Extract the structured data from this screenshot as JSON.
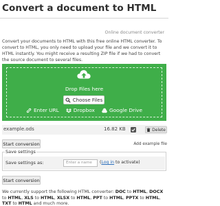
{
  "title": "Convert a document to HTML",
  "subtitle": "Online document converter",
  "intro": "Convert your documents to HTML with this free online HTML converter. To convert to HTML, you only need to upload your file and we convert it to HTML instantly. You might receive a resulting ZIP file if we had to convert the source document to several files.",
  "dropzone": {
    "drop_text": "Drop Files here",
    "choose_label": "Choose Files",
    "sources": [
      "Enter URL",
      "Dropbox",
      "Google Drive"
    ],
    "bg_color": "#3fae49"
  },
  "file": {
    "name": "example.ods",
    "size": "16.82 KB",
    "delete_label": "Delete"
  },
  "start_label": "Start conversion",
  "add_example_label": "Add example file",
  "settings": {
    "legend": "Save settings",
    "save_as_label": "Save settings as:",
    "input_placeholder": "Enter a name",
    "login_link": "Log in",
    "login_suffix": " to activate)",
    "login_prefix": "("
  },
  "support": {
    "prefix": "We currently support the following HTML converter: ",
    "items": [
      {
        "from": "DOC",
        "sep": ", "
      },
      {
        "from": "DOCX",
        "sep": ", "
      },
      {
        "from": "XLS",
        "sep": ", "
      },
      {
        "from": "XLSX",
        "sep": ", "
      },
      {
        "from": "PPT",
        "sep": ", "
      },
      {
        "from": "PPTX",
        "sep": ", "
      },
      {
        "from": "TXT",
        "sep": " "
      }
    ],
    "to_word": " to ",
    "target": "HTML",
    "suffix": "and much more."
  }
}
